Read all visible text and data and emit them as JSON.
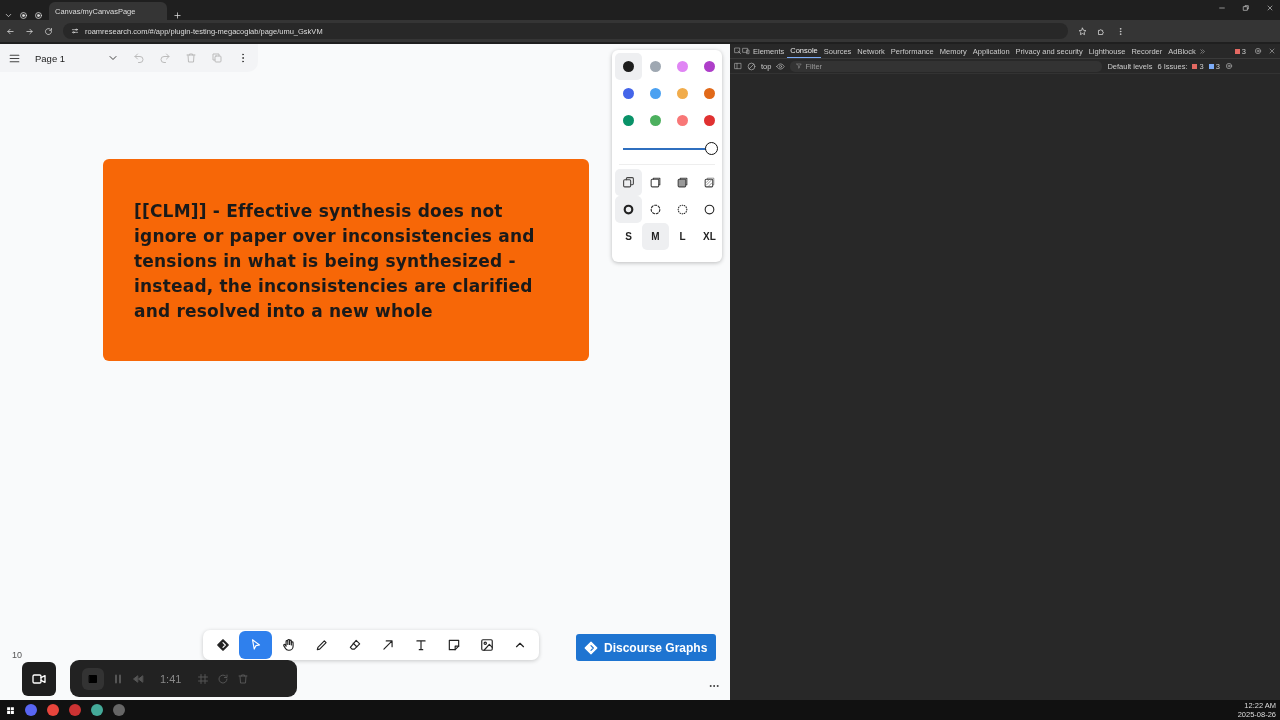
{
  "browser": {
    "tabs": [
      {
        "title": "Canvas/myCanvasPage",
        "selected": true
      }
    ],
    "url": "roamresearch.com/#/app/plugin-testing-megacoglab/page/umu_GskVM"
  },
  "page_toolbar": {
    "page_name": "Page 1"
  },
  "card": {
    "text": "[[CLM]] - Effective synthesis does not ignore or paper over inconsistencies and tensions in what is being synthesized - instead, the inconsistencies are clarified and resolved into a new whole",
    "color": "#f76707"
  },
  "style_panel": {
    "colors": [
      {
        "color": "#1d1d1d",
        "selected": true
      },
      {
        "color": "#9fa8b2",
        "selected": false
      },
      {
        "color": "#e085f4",
        "selected": false
      },
      {
        "color": "#ae3ec9",
        "selected": false
      },
      {
        "color": "#4465e9",
        "selected": false
      },
      {
        "color": "#4ba1f1",
        "selected": false
      },
      {
        "color": "#f1ac4b",
        "selected": false
      },
      {
        "color": "#e16919",
        "selected": false
      },
      {
        "color": "#099268",
        "selected": false
      },
      {
        "color": "#4cb05e",
        "selected": false
      },
      {
        "color": "#f87777",
        "selected": false
      },
      {
        "color": "#e03131",
        "selected": false
      }
    ],
    "opacity": {
      "level": 1
    },
    "fills": [
      {
        "kind": "none",
        "selected": true
      },
      {
        "kind": "semi",
        "selected": false
      },
      {
        "kind": "solid",
        "selected": false
      },
      {
        "kind": "pattern",
        "selected": false
      }
    ],
    "dashes": [
      {
        "kind": "draw",
        "selected": true
      },
      {
        "kind": "dashed",
        "selected": false
      },
      {
        "kind": "dotted",
        "selected": false
      },
      {
        "kind": "solid",
        "selected": false
      }
    ],
    "sizes": [
      {
        "label": "S",
        "selected": false
      },
      {
        "label": "M",
        "selected": true
      },
      {
        "label": "L",
        "selected": false
      },
      {
        "label": "XL",
        "selected": false
      }
    ]
  },
  "tools": [
    {
      "kind": "discourse",
      "selected": false
    },
    {
      "kind": "select",
      "selected": true
    },
    {
      "kind": "hand",
      "selected": false
    },
    {
      "kind": "draw",
      "selected": false
    },
    {
      "kind": "eraser",
      "selected": false
    },
    {
      "kind": "arrow",
      "selected": false
    },
    {
      "kind": "text",
      "selected": false
    },
    {
      "kind": "note",
      "selected": false
    },
    {
      "kind": "media",
      "selected": false
    },
    {
      "kind": "more",
      "selected": false
    }
  ],
  "discourse_button": {
    "label": "Discourse Graphs"
  },
  "zoom": "10",
  "recorder": {
    "time": "1:41"
  },
  "devtools": {
    "tabs": [
      {
        "label": "Elements",
        "selected": false
      },
      {
        "label": "Console",
        "selected": true
      },
      {
        "label": "Sources",
        "selected": false
      },
      {
        "label": "Network",
        "selected": false
      },
      {
        "label": "Performance",
        "selected": false
      },
      {
        "label": "Memory",
        "selected": false
      },
      {
        "label": "Application",
        "selected": false
      },
      {
        "label": "Privacy and security",
        "selected": false
      },
      {
        "label": "Lighthouse",
        "selected": false
      },
      {
        "label": "Recorder",
        "selected": false
      },
      {
        "label": "AdBlock",
        "selected": false
      }
    ],
    "error_count": "3",
    "context": "top",
    "filter_placeholder": "Filter",
    "levels": "Default levels",
    "issues_label": "6 Issues:",
    "issue_errors": "3",
    "issue_infos": "3"
  },
  "taskbar": {
    "time": "12:22 AM",
    "date": "2025-08-26"
  }
}
